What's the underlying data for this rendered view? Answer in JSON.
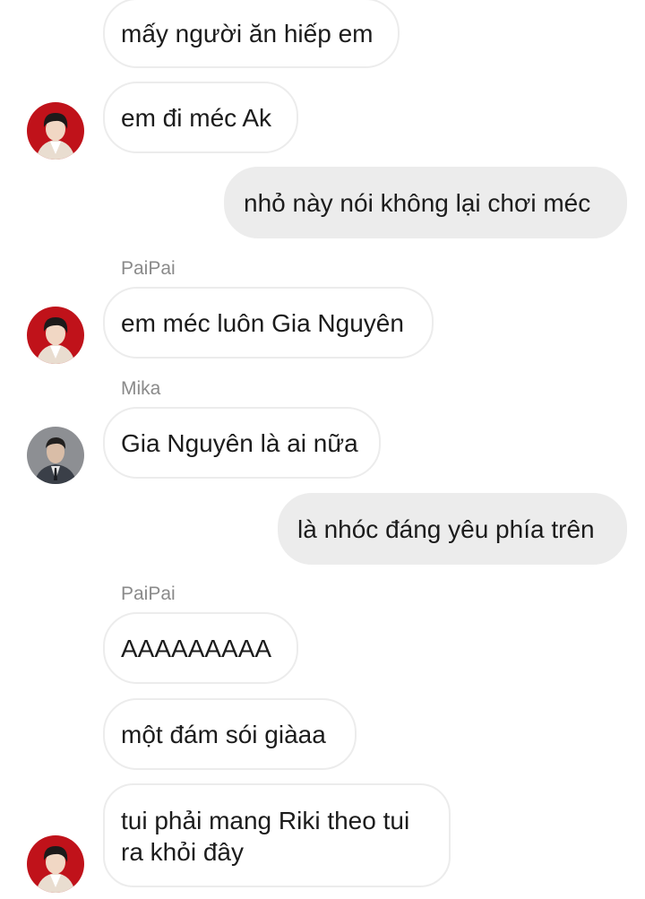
{
  "colors": {
    "incoming_border": "#ececec",
    "outgoing_bg": "#ececec",
    "sender_text": "#8a8a8a",
    "avatar_paipai_bg": "#c0121a",
    "avatar_mika_bg": "#8d8f93"
  },
  "messages": [
    {
      "text": "mấy người ăn hiếp em"
    },
    {
      "text": "em đi méc Ak",
      "avatar": "paipai-avatar"
    },
    {
      "text": "nhỏ này nói không lại chơi méc"
    },
    {
      "sender": "PaiPai",
      "text": "em méc luôn Gia Nguyên",
      "avatar": "paipai-avatar"
    },
    {
      "sender": "Mika",
      "text": "Gia Nguyên là ai nữa",
      "avatar": "mika-avatar"
    },
    {
      "text": "là nhóc đáng yêu phía trên"
    },
    {
      "sender": "PaiPai",
      "text": "AAAAAAAAA"
    },
    {
      "text": "một đám sói giàaa"
    },
    {
      "text": "tui phải mang Riki theo tui ra khỏi đây",
      "avatar": "paipai-avatar"
    }
  ]
}
